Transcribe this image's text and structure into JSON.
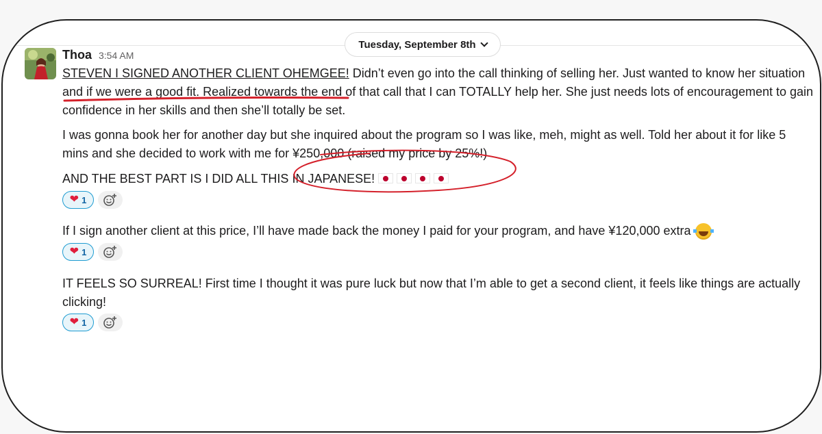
{
  "date_divider": {
    "label": "Tuesday, September 8th"
  },
  "message": {
    "author": "Thoa",
    "timestamp": "3:54 AM",
    "paragraph1_highlight": "STEVEN I SIGNED ANOTHER CLIENT OHEMGEE!",
    "paragraph1_rest": " Didn’t even go into the call thinking of selling her. Just wanted to know her situation and if we were a good fit. Realized towards the end of that call that I can TOTALLY help her. She just needs lots of encouragement to gain confidence in her skills and then she’ll totally be set.",
    "paragraph2_before": "I was gonna book her for another day but she inquired about the program so I was like, meh, might as well. Told her about it for like 5 mins and she decided to work with me for ",
    "paragraph2_price": "¥250,000 (raised my price by 25%!)",
    "paragraph3": "AND THE BEST PART IS I DID ALL THIS IN JAPANESE!",
    "paragraph3_flag_icon": "japan-flag-icon",
    "paragraph3_flag_count": 4
  },
  "followups": [
    {
      "text": "If I sign another client at this price, I’ll have made back the money I paid for your program, and have ¥120,000 extra",
      "emoji": "tears-of-joy-icon"
    },
    {
      "text": "IT FEELS SO SURREAL! First time I thought it was pure luck but now that I’m able to get a second client, it feels like things are actually clicking!"
    }
  ],
  "reactions": [
    {
      "icon": "heart-icon",
      "count": "1"
    },
    {
      "icon": "heart-icon",
      "count": "1"
    },
    {
      "icon": "heart-icon",
      "count": "1"
    }
  ],
  "colors": {
    "annotation_red": "#d4202a",
    "reaction_border": "#1d9bd1",
    "reaction_bg": "#e8f5fa",
    "heart": "#e01e3c"
  }
}
